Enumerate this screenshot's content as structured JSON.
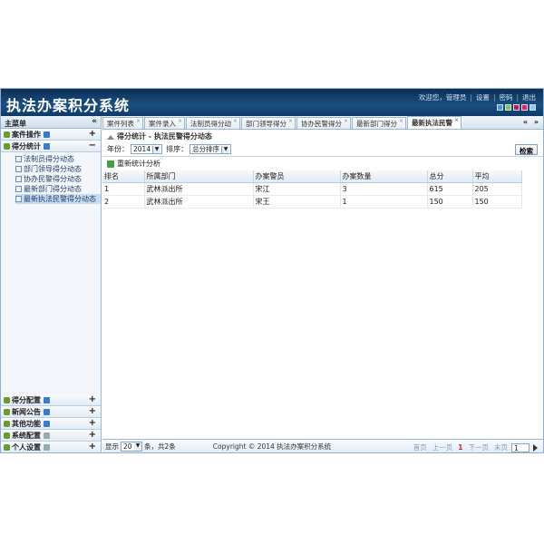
{
  "header": {
    "title": "执法办案积分系统",
    "welcome": "欢迎您，管理员",
    "settings": "设置",
    "password": "密码",
    "logout": "退出",
    "theme_colors": [
      "#3b9be0",
      "#8bc34a",
      "#c2185b",
      "#e91e63",
      "#90caf9"
    ]
  },
  "sidebar": {
    "title": "主菜单",
    "collapse_icon": "«",
    "groups_top": [
      {
        "label": "案件操作",
        "toggle": "+"
      },
      {
        "label": "得分统计",
        "toggle": "−"
      }
    ],
    "subitems": [
      "法制员得分动态",
      "部门领导得分动态",
      "协办民警得分动态",
      "最新部门得分动态",
      "最新执法民警得分动态"
    ],
    "groups_bottom": [
      {
        "label": "得分配置",
        "toggle": "+"
      },
      {
        "label": "新闻公告",
        "toggle": "+"
      },
      {
        "label": "其他功能",
        "toggle": "+"
      },
      {
        "label": "系统配置",
        "toggle": "+"
      },
      {
        "label": "个人设置",
        "toggle": "+"
      }
    ]
  },
  "tabs": [
    "案件列表",
    "案件录入",
    "法制员得分动",
    "部门领导得分",
    "协办民警得分",
    "最新部门得分",
    "最新执法民警"
  ],
  "tab_nav": "« »",
  "breadcrumb": "得分统计 - 执法民警得分动态",
  "filter": {
    "year_label": "年份：",
    "year_value": "2014",
    "sort_label": "排序：",
    "sort_value": "总分排序",
    "search_button": "检索"
  },
  "toolbar": {
    "reanalyze": "重新统计分析"
  },
  "table": {
    "headers": [
      "排名",
      "所属部门",
      "办案警员",
      "办案数量",
      "总分",
      "平均"
    ],
    "rows": [
      [
        "1",
        "武林派出所",
        "宋江",
        "3",
        "615",
        "205"
      ],
      [
        "2",
        "武林派出所",
        "宋王",
        "1",
        "150",
        "150"
      ]
    ]
  },
  "pager": {
    "show_label": "显示",
    "page_size": "20",
    "summary": "条，共2条",
    "first": "首页",
    "prev": "上一页",
    "current": "1",
    "next": "下一页",
    "last": "末页",
    "page_input": "1"
  },
  "footer": "Copyright © 2014 执法办案积分系统"
}
